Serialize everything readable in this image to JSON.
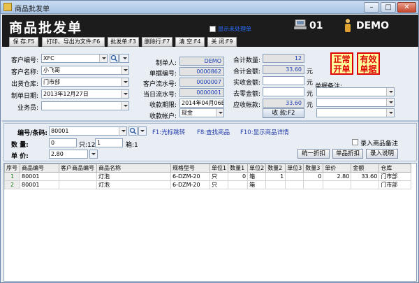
{
  "window": {
    "title": "商品批发单",
    "minimize": "–",
    "maximize": "□",
    "close": "✕"
  },
  "header": {
    "title": "商品批发单",
    "checkbox_label": "显示未处理单",
    "station": "01",
    "user": "DEMO"
  },
  "toolbar": [
    {
      "label": "保  存:F5"
    },
    {
      "label": "打印、导出为文件:F6"
    },
    {
      "label": "批发单:F3"
    },
    {
      "label": "删除行:F7"
    },
    {
      "label": "清  空:F4"
    },
    {
      "label": "关  闭:F9"
    }
  ],
  "form": {
    "customer_code_label": "客户编号:",
    "customer_code": "XFC",
    "customer_name_label": "客户名称:",
    "customer_name": "小飞哥",
    "warehouse_label": "出货仓库:",
    "warehouse": "门市部",
    "date_label": "制单日期:",
    "date": "2013年12月27日",
    "salesman_label": "业务员:",
    "salesman": "",
    "maker_label": "制单人:",
    "maker": "DEMO",
    "doc_no_label": "单据编号:",
    "doc_no": "0000862",
    "cust_serial_label": "客户流水号:",
    "cust_serial": "0000007",
    "day_serial_label": "当日流水号:",
    "day_serial": "0000001",
    "due_label": "收款期限:",
    "due": "2014年04月06E",
    "account_label": "收款帐户:",
    "account": "现金",
    "total_qty_label": "合计数量:",
    "total_qty": "12",
    "total_amount_label": "合计金额:",
    "total_amount": "33.60",
    "received_label": "实收金额:",
    "received": "",
    "rounding_label": "去零金额:",
    "rounding": "",
    "receivable_label": "应收帐款:",
    "receivable": "33.60",
    "yuan": "元",
    "collect_button": "收  款:F2",
    "normal_button": "正常开单",
    "valid_button": "有效单据",
    "remark_label": "单据备注:"
  },
  "entry": {
    "code_label": "编号/条码:",
    "code": "80001",
    "hint1": "F1:光标跳转",
    "hint2": "F8:查找商品",
    "hint3": "F10:显示商品详情",
    "qty_label": "数   量:",
    "qty": "0",
    "only_label": "只:12",
    "box_value": "1",
    "box_label": "箱:1",
    "price_label": "单   价:",
    "price": "2.80",
    "remark_checkbox": "录入商品备注",
    "btn_discount": "统一折扣",
    "btn_item_discount": "单品折扣",
    "btn_entry_help": "录入说明"
  },
  "table": {
    "columns": [
      "序号",
      "商品编号",
      "客户商品编号",
      "商品名称",
      "规格型号",
      "单位1",
      "数量1",
      "单位2",
      "数量2",
      "单位3",
      "数量3",
      "单价",
      "金额",
      "仓库"
    ],
    "rows": [
      [
        "1",
        "80001",
        "",
        "灯泡",
        "6-DZM-20",
        "只",
        "0",
        "箱",
        "1",
        "",
        "0",
        "2.80",
        "33.60",
        "门市部"
      ],
      [
        "2",
        "80001",
        "",
        "灯泡",
        "6-DZM-20",
        "只",
        "",
        "箱",
        "",
        "",
        "",
        "",
        "",
        "门市部"
      ]
    ]
  },
  "colors": {
    "header_bg": "#1c1c1c",
    "accent_red": "#dd0000",
    "link_blue": "#203aa8"
  }
}
